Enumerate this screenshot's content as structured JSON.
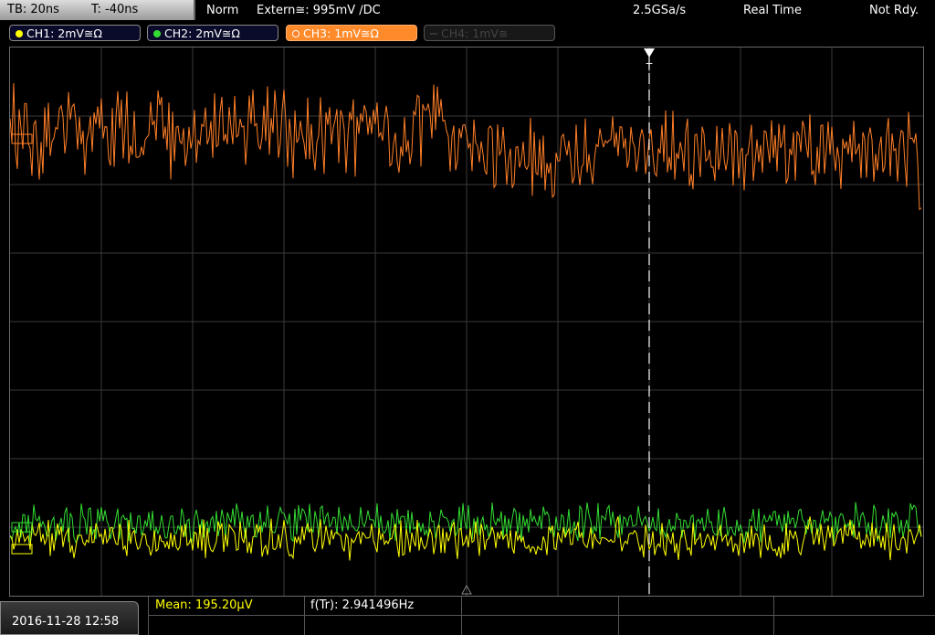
{
  "topbar": {
    "timebase": "TB: 20ns",
    "trigger_offset": "T: -40ns",
    "mode": "Norm",
    "trigger_source": "Extern≅: 995mV ∕DC",
    "sample_rate": "2.5GSa/s",
    "acquisition": "Real Time",
    "status": "Not Rdy."
  },
  "channels": [
    {
      "label": "CH1: 2mV≅Ω",
      "color": "#ffff00",
      "state": "on"
    },
    {
      "label": "CH2: 2mV≅Ω",
      "color": "#33dd33",
      "state": "on"
    },
    {
      "label": "CH3: 1mV≅Ω",
      "color": "#ff7f27",
      "state": "active"
    },
    {
      "label": "CH4: 1mV≅",
      "color": "#444444",
      "state": "off"
    }
  ],
  "colors": {
    "ch1": "#ffff00",
    "ch2": "#33dd33",
    "ch3": "#ff7f27",
    "grid": "#3a3a3a",
    "trigger_marker": "#ffffff"
  },
  "trigger_marker_label": "T",
  "measurements": {
    "mean": "Mean: 195.20µV",
    "frequency": "f(Tr): 2.941496Hz"
  },
  "datetime": "2016-11-28 12:58"
}
